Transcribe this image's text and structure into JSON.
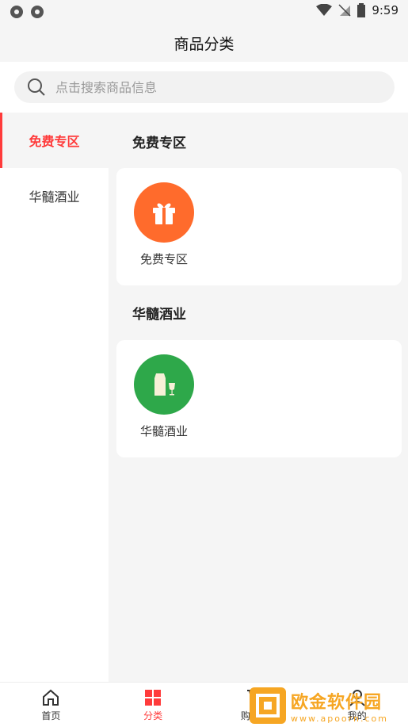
{
  "status_bar": {
    "time": "9:59"
  },
  "header": {
    "title": "商品分类"
  },
  "search": {
    "placeholder": "点击搜索商品信息"
  },
  "sidebar": {
    "items": [
      {
        "label": "免费专区",
        "active": true
      },
      {
        "label": "华髓酒业",
        "active": false
      }
    ]
  },
  "sections": [
    {
      "title": "免费专区",
      "items": [
        {
          "label": "免费专区",
          "icon": "gift-icon"
        }
      ]
    },
    {
      "title": "华髓酒业",
      "items": [
        {
          "label": "华髓酒业",
          "icon": "wine-icon"
        }
      ]
    }
  ],
  "tabbar": {
    "items": [
      {
        "label": "首页",
        "icon": "home-icon"
      },
      {
        "label": "分类",
        "icon": "category-icon"
      },
      {
        "label": "购物车",
        "icon": "cart-icon"
      },
      {
        "label": "我的",
        "icon": "user-icon"
      }
    ],
    "active_index": 1
  },
  "watermark": {
    "title": "欧金软件园",
    "url": "www.apoorn.com"
  },
  "colors": {
    "accent": "#ff3b3b",
    "gift": "#ff6b2c",
    "wine": "#2ea84a",
    "watermark": "#f6a623"
  }
}
